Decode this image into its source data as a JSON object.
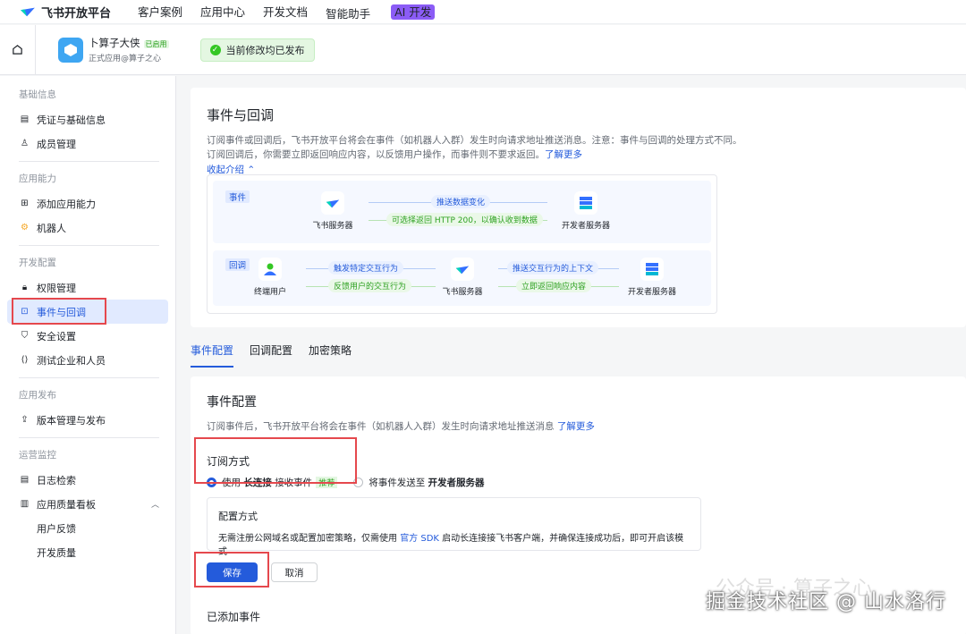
{
  "topbar": {
    "brand": "飞书开放平台",
    "nav": [
      "客户案例",
      "应用中心",
      "开发文档",
      "智能助手"
    ],
    "ai_badge": "AI 开发"
  },
  "app": {
    "name": "卜算子大侠",
    "badge": "已启用",
    "subtitle": "正式应用@算子之心",
    "status": "当前修改均已发布"
  },
  "sidebar": {
    "groups": [
      {
        "title": "基础信息",
        "items": [
          "凭证与基础信息",
          "成员管理"
        ]
      },
      {
        "title": "应用能力",
        "items": [
          "添加应用能力",
          "机器人"
        ]
      },
      {
        "title": "开发配置",
        "items": [
          "权限管理",
          "事件与回调",
          "安全设置",
          "测试企业和人员"
        ]
      },
      {
        "title": "应用发布",
        "items": [
          "版本管理与发布"
        ]
      },
      {
        "title": "运营监控",
        "items": [
          "日志检索",
          "应用质量看板",
          "用户反馈",
          "开发质量"
        ]
      }
    ]
  },
  "intro": {
    "title": "事件与回调",
    "desc1": "订阅事件或回调后，飞书开放平台将会在事件（如机器人入群）发生时向请求地址推送消息。注意：事件与回调的处理方式不同。",
    "desc2": "订阅回调后，你需要立即返回响应内容，以反馈用户操作，而事件则不要求返回。",
    "learn_more": "了解更多",
    "collapse": "收起介绍"
  },
  "diagram": {
    "event_tag": "事件",
    "callback_tag": "回调",
    "feishu_server": "飞书服务器",
    "dev_server": "开发者服务器",
    "end_user": "终端用户",
    "push_change": "推送数据变化",
    "return_200": "可选择返回 HTTP 200，以确认收到数据",
    "trigger_action": "触发特定交互行为",
    "push_context": "推送交互行为的上下文",
    "feedback": "反馈用户的交互行为",
    "return_now": "立即返回响应内容"
  },
  "tabs": [
    "事件配置",
    "回调配置",
    "加密策略"
  ],
  "config": {
    "title": "事件配置",
    "desc": "订阅事件后，飞书开放平台将会在事件（如机器人入群）发生时向请求地址推送消息",
    "learn_more": "了解更多",
    "sub_title": "订阅方式",
    "opt1_pre": "使用",
    "opt1_bold": "长连接",
    "opt1_post": "接收事件",
    "recommend": "推荐",
    "opt2_pre": "将事件发送至",
    "opt2_bold": "开发者服务器",
    "mode_title": "配置方式",
    "mode_desc_pre": "无需注册公网域名或配置加密策略，仅需使用",
    "mode_link": "官方 SDK",
    "mode_desc_post": "启动长连接接飞书客户端，并确保连接成功后，即可开启该模式",
    "save": "保存",
    "cancel": "取消",
    "added": "已添加事件"
  },
  "watermark": "掘金技术社区 @ 山水洛行",
  "watermark_faint": "公众号 · 算子之心"
}
